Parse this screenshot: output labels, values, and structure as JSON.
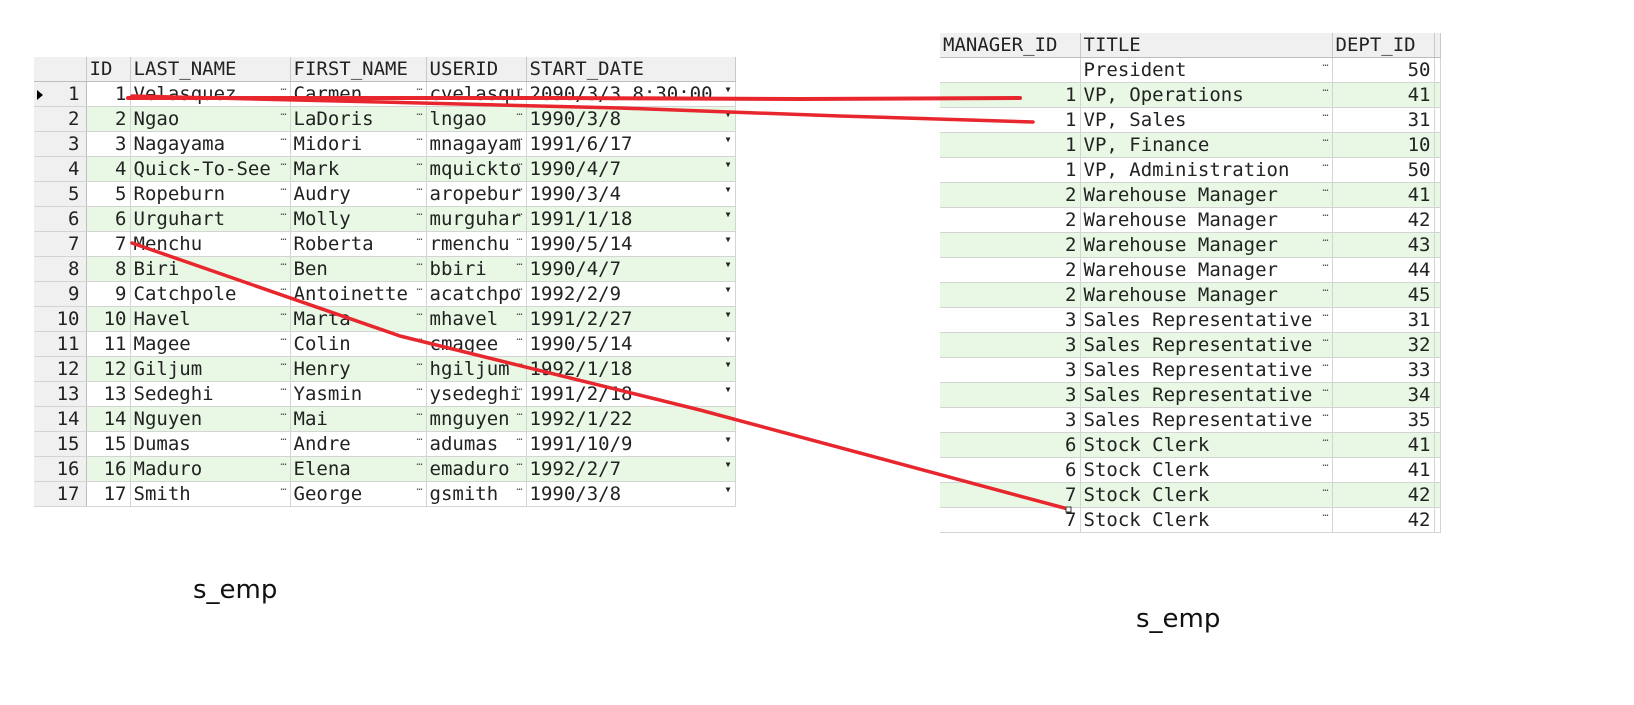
{
  "left_table": {
    "caption": "s_emp",
    "columns": [
      "ID",
      "LAST_NAME",
      "FIRST_NAME",
      "USERID",
      "START_DATE"
    ],
    "rows": [
      {
        "rownum": "1",
        "id": "1",
        "last_name": "Velasquez",
        "first_name": "Carmen",
        "userid": "cvelasqu",
        "start_date": "2090/3/3 8:30:00"
      },
      {
        "rownum": "2",
        "id": "2",
        "last_name": "Ngao",
        "first_name": "LaDoris",
        "userid": "lngao",
        "start_date": "1990/3/8"
      },
      {
        "rownum": "3",
        "id": "3",
        "last_name": "Nagayama",
        "first_name": "Midori",
        "userid": "mnagayam",
        "start_date": "1991/6/17"
      },
      {
        "rownum": "4",
        "id": "4",
        "last_name": "Quick-To-See",
        "first_name": "Mark",
        "userid": "mquickto",
        "start_date": "1990/4/7"
      },
      {
        "rownum": "5",
        "id": "5",
        "last_name": "Ropeburn",
        "first_name": "Audry",
        "userid": "aropebur",
        "start_date": "1990/3/4"
      },
      {
        "rownum": "6",
        "id": "6",
        "last_name": "Urguhart",
        "first_name": "Molly",
        "userid": "murguhar",
        "start_date": "1991/1/18"
      },
      {
        "rownum": "7",
        "id": "7",
        "last_name": "Menchu",
        "first_name": "Roberta",
        "userid": "rmenchu",
        "start_date": "1990/5/14"
      },
      {
        "rownum": "8",
        "id": "8",
        "last_name": "Biri",
        "first_name": "Ben",
        "userid": "bbiri",
        "start_date": "1990/4/7"
      },
      {
        "rownum": "9",
        "id": "9",
        "last_name": "Catchpole",
        "first_name": "Antoinette",
        "userid": "acatchpo",
        "start_date": "1992/2/9"
      },
      {
        "rownum": "10",
        "id": "10",
        "last_name": "Havel",
        "first_name": "Marta",
        "userid": "mhavel",
        "start_date": "1991/2/27"
      },
      {
        "rownum": "11",
        "id": "11",
        "last_name": "Magee",
        "first_name": "Colin",
        "userid": "cmagee",
        "start_date": "1990/5/14"
      },
      {
        "rownum": "12",
        "id": "12",
        "last_name": "Giljum",
        "first_name": "Henry",
        "userid": "hgiljum",
        "start_date": "1992/1/18"
      },
      {
        "rownum": "13",
        "id": "13",
        "last_name": "Sedeghi",
        "first_name": "Yasmin",
        "userid": "ysedeghi",
        "start_date": "1991/2/18"
      },
      {
        "rownum": "14",
        "id": "14",
        "last_name": "Nguyen",
        "first_name": "Mai",
        "userid": "mnguyen",
        "start_date": "1992/1/22"
      },
      {
        "rownum": "15",
        "id": "15",
        "last_name": "Dumas",
        "first_name": "Andre",
        "userid": "adumas",
        "start_date": "1991/10/9"
      },
      {
        "rownum": "16",
        "id": "16",
        "last_name": "Maduro",
        "first_name": "Elena",
        "userid": "emaduro",
        "start_date": "1992/2/7"
      },
      {
        "rownum": "17",
        "id": "17",
        "last_name": "Smith",
        "first_name": "George",
        "userid": "gsmith",
        "start_date": "1990/3/8"
      }
    ]
  },
  "right_table": {
    "caption": "s_emp",
    "columns": [
      "MANAGER_ID",
      "TITLE",
      "DEPT_ID"
    ],
    "rows": [
      {
        "manager_id": "",
        "title": "President",
        "dept_id": "50"
      },
      {
        "manager_id": "1",
        "title": "VP, Operations",
        "dept_id": "41"
      },
      {
        "manager_id": "1",
        "title": "VP, Sales",
        "dept_id": "31"
      },
      {
        "manager_id": "1",
        "title": "VP, Finance",
        "dept_id": "10"
      },
      {
        "manager_id": "1",
        "title": "VP, Administration",
        "dept_id": "50"
      },
      {
        "manager_id": "2",
        "title": "Warehouse Manager",
        "dept_id": "41"
      },
      {
        "manager_id": "2",
        "title": "Warehouse Manager",
        "dept_id": "42"
      },
      {
        "manager_id": "2",
        "title": "Warehouse Manager",
        "dept_id": "43"
      },
      {
        "manager_id": "2",
        "title": "Warehouse Manager",
        "dept_id": "44"
      },
      {
        "manager_id": "2",
        "title": "Warehouse Manager",
        "dept_id": "45"
      },
      {
        "manager_id": "3",
        "title": "Sales Representative",
        "dept_id": "31"
      },
      {
        "manager_id": "3",
        "title": "Sales Representative",
        "dept_id": "32"
      },
      {
        "manager_id": "3",
        "title": "Sales Representative",
        "dept_id": "33"
      },
      {
        "manager_id": "3",
        "title": "Sales Representative",
        "dept_id": "34"
      },
      {
        "manager_id": "3",
        "title": "Sales Representative",
        "dept_id": "35"
      },
      {
        "manager_id": "6",
        "title": "Stock Clerk",
        "dept_id": "41"
      },
      {
        "manager_id": "6",
        "title": "Stock Clerk",
        "dept_id": "41"
      },
      {
        "manager_id": "7",
        "title": "Stock Clerk",
        "dept_id": "42"
      },
      {
        "manager_id": "7",
        "title": "Stock Clerk",
        "dept_id": "42"
      }
    ]
  },
  "annotation_color": "#e8262d",
  "icons": {
    "row_marker": "current-row-triangle-icon",
    "cell_menu": "cell-ellipsis-icon",
    "cell_dropdown": "dropdown-arrow-icon"
  }
}
